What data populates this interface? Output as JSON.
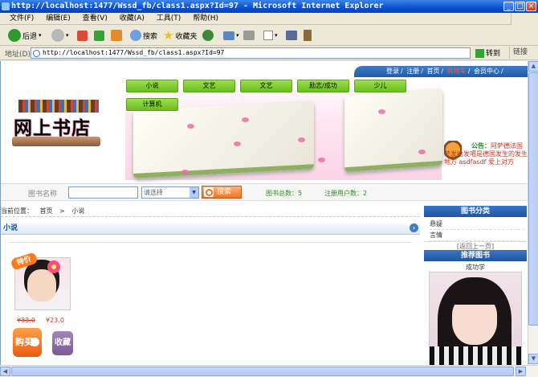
{
  "window": {
    "title": "http://localhost:1477/Wssd_fb/class1.aspx?Id=97 - Microsoft Internet Explorer"
  },
  "menu": [
    "文件(F)",
    "编辑(E)",
    "查看(V)",
    "收藏(A)",
    "工具(T)",
    "帮助(H)"
  ],
  "toolbar": {
    "back": "后退",
    "search": "搜索",
    "favorites": "收藏夹",
    "go": "转到",
    "links": "链接"
  },
  "address": {
    "label": "地址(D)",
    "url": "http://localhost:1477/Wssd_fb/class1.aspx?Id=97"
  },
  "toplinks": [
    "登录",
    "注册",
    "首页",
    "购物车",
    "会员中心"
  ],
  "logo": "网上书店",
  "categories": [
    "小说",
    "文艺",
    "文艺",
    "励志/成功",
    "少儿",
    "计算机"
  ],
  "notice": {
    "title": "公告：",
    "highlight": "阿萨德法国",
    "body": "萨发给发噶是德国发生的发生地方 asdfasdf 爱上对方"
  },
  "search": {
    "label": "图书名称",
    "select": "请选择",
    "button": "搜索",
    "total_books": "图书总数：5",
    "total_users": "注册用户数：2"
  },
  "breadcrumb": {
    "prefix": "当前位置：",
    "home": "首页",
    "current": "小说"
  },
  "section": {
    "title": "小说"
  },
  "product": {
    "tag": "特价",
    "old_price": "¥33.0",
    "new_price": "¥23.0",
    "buy": "购买",
    "fav": "收藏"
  },
  "sidebar": {
    "cat_title": "图书分类",
    "cat_items": [
      "悬疑",
      "言情"
    ],
    "pager": "[返回上一页]",
    "rec_title": "推荐图书",
    "rec_name": "成功学"
  },
  "colors": {
    "accent": "#1e55a2",
    "category_green": "#6cbc1f",
    "price_red": "#c0392b"
  }
}
